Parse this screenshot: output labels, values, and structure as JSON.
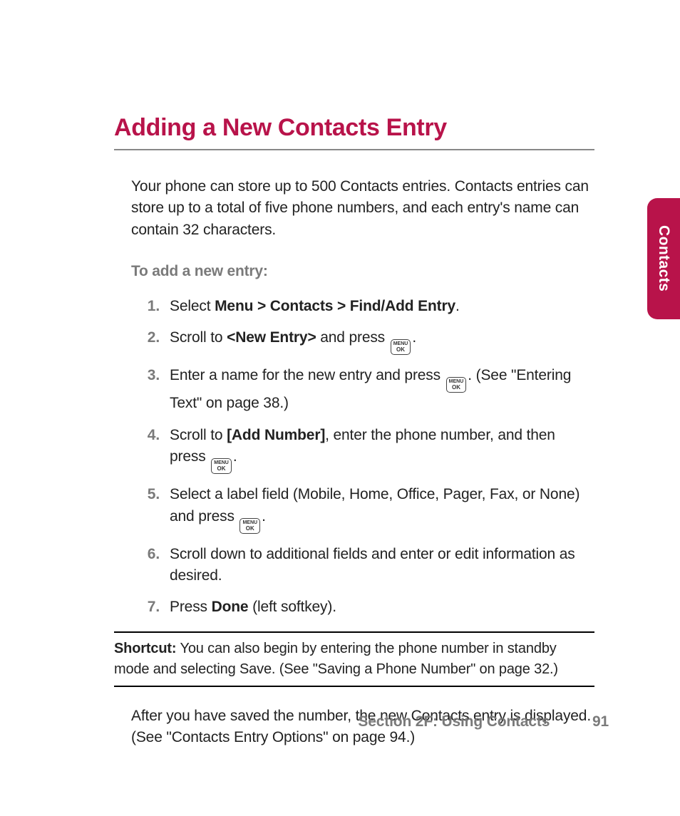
{
  "accent_color": "#b8134a",
  "tab_label": "Contacts",
  "heading": "Adding a New Contacts Entry",
  "intro": "Your phone can store up to 500 Contacts entries. Contacts entries can store up to a total of five phone numbers, and each entry's name can contain 32 characters.",
  "subhead": "To add a new entry:",
  "key_icon": {
    "top": "MENU",
    "bottom": "OK"
  },
  "steps": [
    {
      "num": "1.",
      "pre": "Select ",
      "bold": "Menu > Contacts > Find/Add Entry",
      "post": "."
    },
    {
      "num": "2.",
      "pre": "Scroll to ",
      "bold": "<New Entry>",
      "mid": " and press ",
      "has_key": true,
      "post": "."
    },
    {
      "num": "3.",
      "pre": "Enter a name for the new entry and press ",
      "has_key": true,
      "post": ". (See \"Entering Text\" on page 38.)"
    },
    {
      "num": "4.",
      "pre": "Scroll to ",
      "bold": "[Add Number]",
      "mid": ", enter the phone number, and then press ",
      "has_key": true,
      "post": "."
    },
    {
      "num": "5.",
      "pre": "Select a label field (Mobile, Home, Office, Pager, Fax, or None) and press ",
      "has_key": true,
      "post": "."
    },
    {
      "num": "6.",
      "pre": "Scroll down to additional fields and enter or edit information as desired."
    },
    {
      "num": "7.",
      "pre": "Press ",
      "bold": "Done",
      "post": " (left softkey)."
    }
  ],
  "shortcut_label": "Shortcut:",
  "shortcut_text": " You can also begin by entering the phone number in standby mode and selecting Save. (See \"Saving a Phone Number\" on page 32.)",
  "after_text": "After you have saved the number, the new Contacts entry is displayed. (See \"Contacts Entry Options\" on page 94.)",
  "footer_section": "Section 2F: Using Contacts",
  "footer_page": "91"
}
